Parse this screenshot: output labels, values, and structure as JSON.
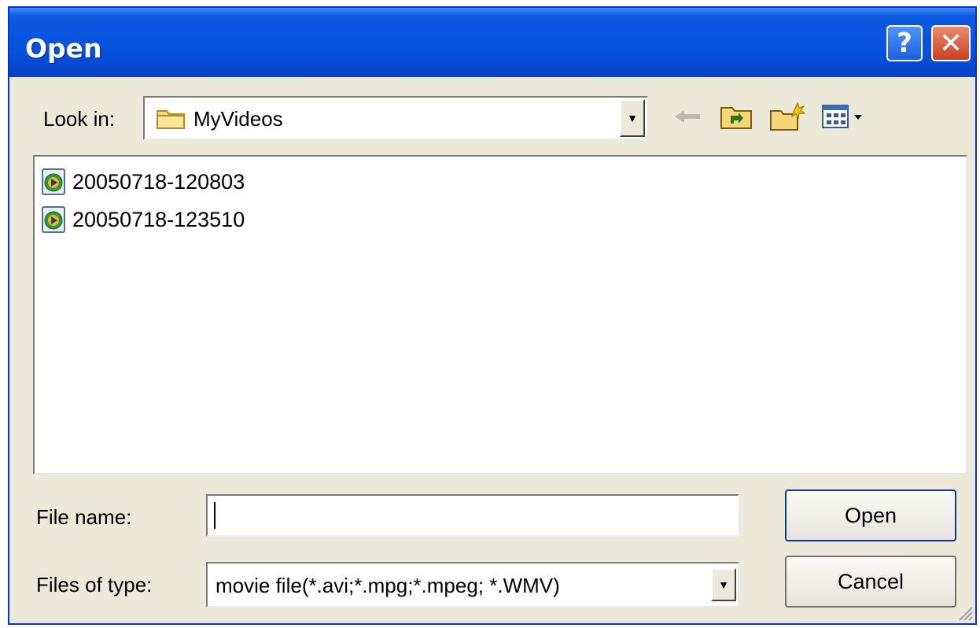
{
  "window": {
    "title": "Open",
    "help_label": "?",
    "close_label": "✕"
  },
  "look_in": {
    "label": "Look in:",
    "value": "MyVideos"
  },
  "toolbar": {
    "back_icon": "back-arrow-icon",
    "up_icon": "up-folder-icon",
    "new_folder_icon": "new-folder-icon",
    "views_icon": "views-menu-icon"
  },
  "files": [
    {
      "name": "20050718-120803",
      "icon": "video-file-icon"
    },
    {
      "name": "20050718-123510",
      "icon": "video-file-icon"
    }
  ],
  "file_name": {
    "label": "File name:",
    "value": ""
  },
  "file_type": {
    "label": "Files of type:",
    "value": "movie file(*.avi;*.mpg;*.mpeg; *.WMV)"
  },
  "buttons": {
    "open": "Open",
    "cancel": "Cancel"
  },
  "colors": {
    "titlebar": "#0752df",
    "dialog_bg": "#ece9d8",
    "close_btn": "#c84020"
  }
}
